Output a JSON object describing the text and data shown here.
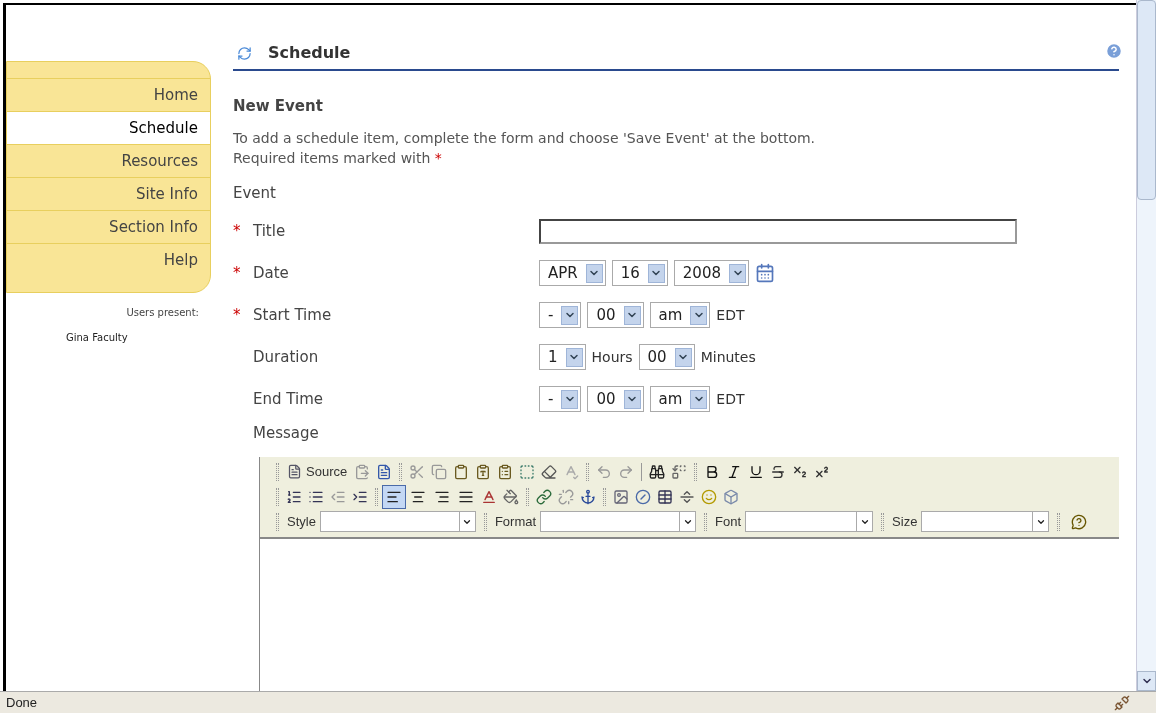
{
  "sidebar": {
    "items": [
      {
        "label": "Home",
        "selected": false
      },
      {
        "label": "Schedule",
        "selected": true
      },
      {
        "label": "Resources",
        "selected": false
      },
      {
        "label": "Site Info",
        "selected": false
      },
      {
        "label": "Section Info",
        "selected": false
      },
      {
        "label": "Help",
        "selected": false
      }
    ],
    "users_label": "Users present:",
    "users": [
      "Gina Faculty"
    ]
  },
  "header": {
    "title": "Schedule"
  },
  "form": {
    "title": "New Event",
    "intro": "To add a schedule item, complete the form and choose 'Save Event' at the bottom.",
    "required_note": "Required items marked with",
    "required_mark": "*",
    "section": "Event",
    "fields": [
      {
        "label": "Title",
        "required": true,
        "parts": [
          {
            "kind": "input"
          }
        ]
      },
      {
        "label": "Date",
        "required": true,
        "parts": [
          {
            "kind": "select",
            "value": "APR"
          },
          {
            "kind": "select",
            "value": "16"
          },
          {
            "kind": "select",
            "value": "2008"
          },
          {
            "kind": "calendar"
          }
        ]
      },
      {
        "label": "Start Time",
        "required": true,
        "parts": [
          {
            "kind": "select",
            "value": "-"
          },
          {
            "kind": "select",
            "value": "00"
          },
          {
            "kind": "select",
            "value": "am"
          },
          {
            "kind": "text",
            "text": "EDT"
          }
        ]
      },
      {
        "label": "Duration",
        "required": false,
        "parts": [
          {
            "kind": "select",
            "value": "1"
          },
          {
            "kind": "text",
            "text": "Hours"
          },
          {
            "kind": "select",
            "value": "00"
          },
          {
            "kind": "text",
            "text": "Minutes"
          }
        ]
      },
      {
        "label": "End Time",
        "required": false,
        "parts": [
          {
            "kind": "select",
            "value": "-"
          },
          {
            "kind": "select",
            "value": "00"
          },
          {
            "kind": "select",
            "value": "am"
          },
          {
            "kind": "text",
            "text": "EDT"
          }
        ]
      }
    ],
    "message_label": "Message"
  },
  "editor": {
    "source_label": "Source",
    "alignment": [
      {
        "selected": true
      },
      {
        "selected": false
      },
      {
        "selected": false
      },
      {
        "selected": false
      }
    ],
    "combos": [
      {
        "label": "Style"
      },
      {
        "label": "Format"
      },
      {
        "label": "Font"
      },
      {
        "label": "Size"
      }
    ]
  },
  "status_bar": {
    "text": "Done"
  }
}
